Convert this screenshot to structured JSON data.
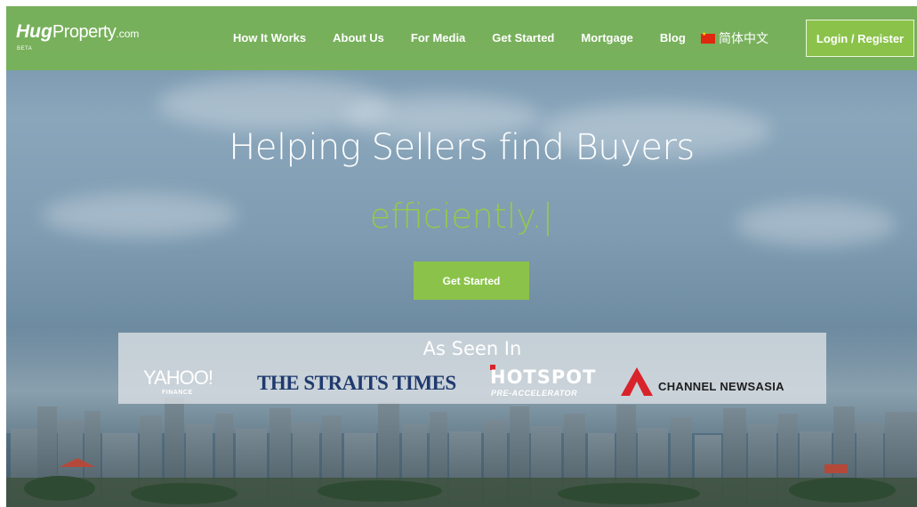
{
  "brand": {
    "logo_hug": "Hug",
    "logo_property": "Property",
    "logo_com": ".com",
    "logo_beta": "BETA"
  },
  "nav": {
    "items": [
      {
        "label": "How It Works"
      },
      {
        "label": "About Us"
      },
      {
        "label": "For Media"
      },
      {
        "label": "Get Started"
      },
      {
        "label": "Mortgage"
      },
      {
        "label": "Blog"
      }
    ],
    "language": "简体中文",
    "login_label": "Login / Register"
  },
  "hero": {
    "title": "Helping Sellers find Buyers",
    "subtitle": "efficiently.",
    "cursor": "|",
    "cta_label": "Get Started"
  },
  "press": {
    "heading": "As Seen In",
    "yahoo": "YAHOO!",
    "yahoo_sub": "FINANCE",
    "straits": "THE STRAITS TIMES",
    "hotspot": "HOTSPOT",
    "hotspot_sub": "PRE-ACCELERATOR",
    "cna": "CHANNEL NEWSASIA"
  },
  "colors": {
    "accent": "#8bc34a",
    "nav_bg": "#78b450",
    "subtitle": "#95c84d",
    "straits": "#1f3a6e",
    "cna_red": "#d8232a"
  },
  "icons": {
    "flag": "china-flag-icon",
    "cna": "channel-newsasia-logo-icon"
  }
}
